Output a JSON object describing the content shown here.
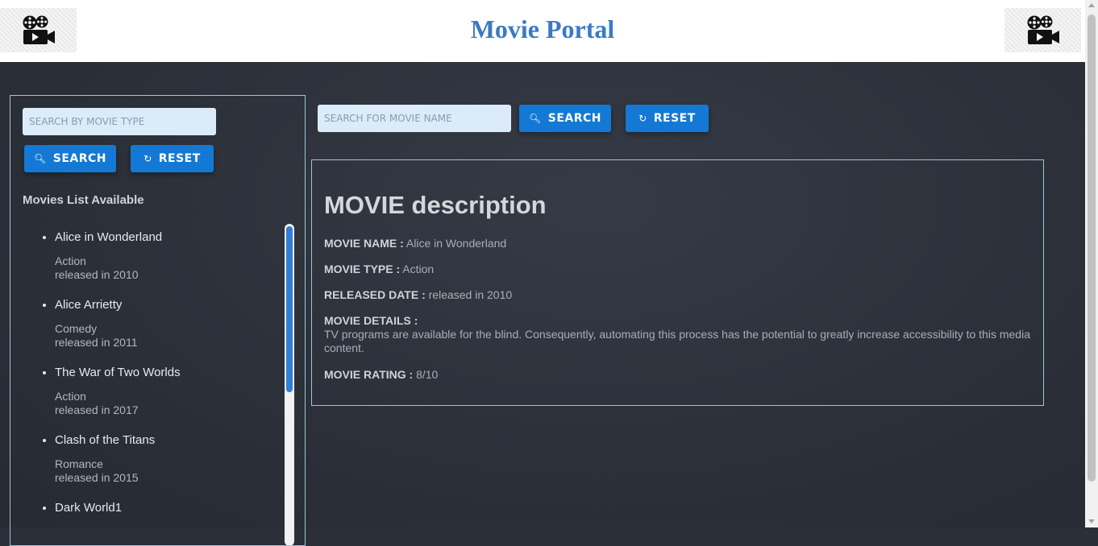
{
  "header": {
    "title": "Movie Portal",
    "logo_icon": "movie-camera-icon"
  },
  "sidebar": {
    "search_placeholder": "SEARCH BY MOVIE TYPE",
    "search_label": "SEARCH",
    "reset_label": "RESET",
    "list_heading": "Movies List Available",
    "movies": [
      {
        "name": "Alice in Wonderland",
        "type": "Action",
        "released": "released in 2010"
      },
      {
        "name": "Alice Arrietty",
        "type": "Comedy",
        "released": "released in 2011"
      },
      {
        "name": "The War of Two Worlds",
        "type": "Action",
        "released": "released in 2017"
      },
      {
        "name": "Clash of the Titans",
        "type": "Romance",
        "released": "released in 2015"
      },
      {
        "name": "Dark World1",
        "type": "",
        "released": ""
      }
    ]
  },
  "main": {
    "search_placeholder": "SEARCH FOR MOVIE NAME",
    "search_label": "SEARCH",
    "reset_label": "RESET",
    "description": {
      "title": "MOVIE description",
      "name_label": "MOVIE NAME :",
      "name_value": "Alice in Wonderland",
      "type_label": "MOVIE TYPE :",
      "type_value": "Action",
      "released_label": "RELEASED DATE :",
      "released_value": "released in 2010",
      "details_label": "MOVIE DETAILS :",
      "details_value": "TV programs are available for the blind. Consequently, automating this process has the potential to greatly increase accessibility to this media content.",
      "rating_label": "MOVIE RATING :",
      "rating_value": "8/10"
    }
  },
  "colors": {
    "accent": "#1379d4",
    "title": "#3a7ac4",
    "background": "#2b2f38",
    "border": "#9ec6d6"
  }
}
